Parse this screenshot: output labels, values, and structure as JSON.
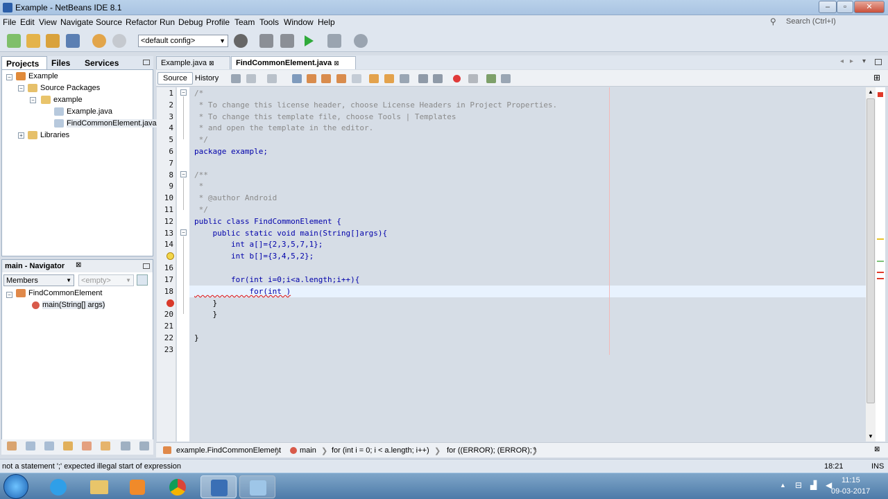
{
  "window": {
    "title": "Example - NetBeans IDE 8.1"
  },
  "menu": [
    "File",
    "Edit",
    "View",
    "Navigate",
    "Source",
    "Refactor",
    "Run",
    "Debug",
    "Profile",
    "Team",
    "Tools",
    "Window",
    "Help"
  ],
  "search": {
    "placeholder": "Search (Ctrl+I)"
  },
  "toolbar": {
    "config": "<default config>"
  },
  "projects_panel": {
    "tabs": [
      "Projects",
      "Files",
      "Services"
    ],
    "tree": [
      "Example",
      "Source Packages",
      "example",
      "Example.java",
      "FindCommonElement.java",
      "Libraries"
    ]
  },
  "navigator": {
    "title": "main - Navigator",
    "filter": "Members",
    "search": "<empty>",
    "tree": [
      "FindCommonElement",
      "main(String[] args)"
    ]
  },
  "editor": {
    "tabs": [
      "Example.java",
      "FindCommonElement.java"
    ],
    "view_tabs": [
      "Source",
      "History"
    ],
    "lines": [
      {
        "n": "1",
        "text": "/*"
      },
      {
        "n": "2",
        "text": " * To change this license header, choose License Headers in Project Properties."
      },
      {
        "n": "3",
        "text": " * To change this template file, choose Tools | Templates"
      },
      {
        "n": "4",
        "text": " * and open the template in the editor."
      },
      {
        "n": "5",
        "text": " */"
      },
      {
        "n": "6",
        "text": "package example;"
      },
      {
        "n": "7",
        "text": ""
      },
      {
        "n": "8",
        "text": "/**"
      },
      {
        "n": "9",
        "text": " *"
      },
      {
        "n": "10",
        "text": " * @author Android"
      },
      {
        "n": "11",
        "text": " */"
      },
      {
        "n": "12",
        "text": "public class FindCommonElement {"
      },
      {
        "n": "13",
        "text": "    public static void main(String[]args){"
      },
      {
        "n": "14",
        "text": "        int a[]={2,3,5,7,1};"
      },
      {
        "n": "15",
        "text": "        int b[]={3,4,5,2};"
      },
      {
        "n": "16",
        "text": ""
      },
      {
        "n": "17",
        "text": "        for(int i=0;i<a.length;i++){"
      },
      {
        "n": "18",
        "text": "            for(int )"
      },
      {
        "n": "19",
        "text": "    }"
      },
      {
        "n": "20",
        "text": "    }"
      },
      {
        "n": "21",
        "text": ""
      },
      {
        "n": "22",
        "text": "}"
      },
      {
        "n": "23",
        "text": ""
      }
    ]
  },
  "breadcrumbs": [
    "example.FindCommonElement",
    "main",
    "for (int i = 0; i < a.length; i++)",
    "for ((ERROR); (ERROR); )"
  ],
  "status": {
    "message": "not a statement  ';' expected  illegal start of expression",
    "position": "18:21",
    "mode": "INS"
  },
  "taskbar": {
    "time": "11:15",
    "date": "09-03-2017"
  }
}
